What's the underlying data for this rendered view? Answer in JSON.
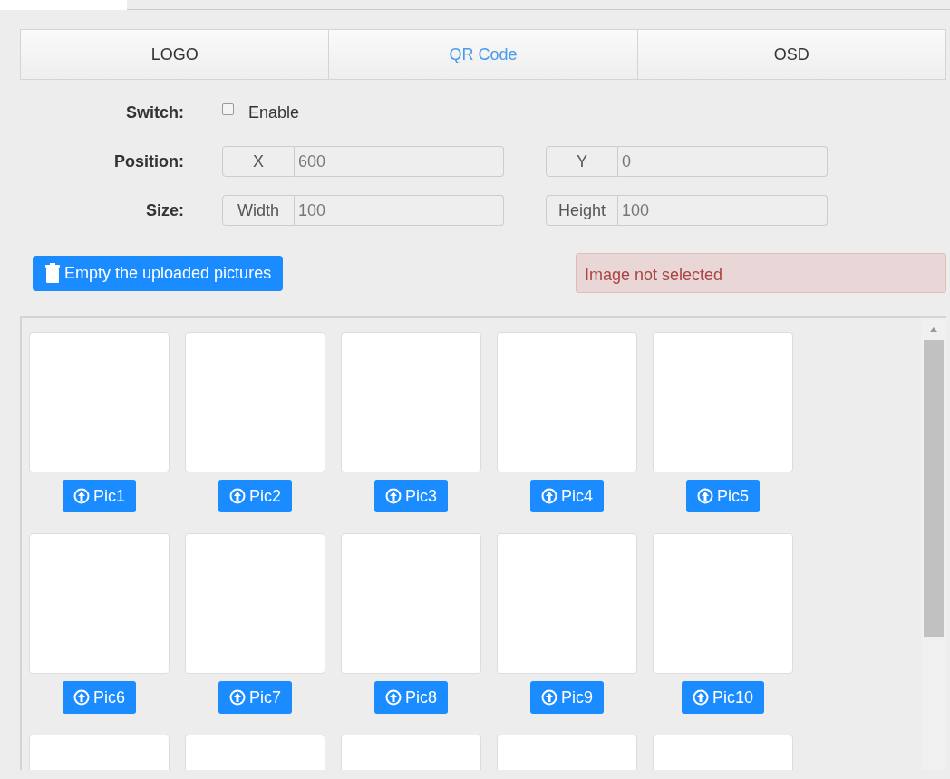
{
  "tabs": [
    {
      "label": "LOGO",
      "selected": false
    },
    {
      "label": "QR Code",
      "selected": true
    },
    {
      "label": "OSD",
      "selected": false
    }
  ],
  "switch": {
    "label": "Switch:",
    "option": "Enable",
    "checked": false
  },
  "position": {
    "label": "Position:",
    "fields": [
      {
        "addon": "X",
        "value": "600"
      },
      {
        "addon": "Y",
        "value": "0"
      }
    ]
  },
  "size": {
    "label": "Size:",
    "fields": [
      {
        "addon": "Width",
        "value": "100"
      },
      {
        "addon": "Height",
        "value": "100"
      }
    ]
  },
  "empty_button": "Empty the uploaded pictures",
  "alert": "Image not selected",
  "pictures": [
    {
      "kind": "upload",
      "label": "Pic1"
    },
    {
      "kind": "upload",
      "label": "Pic2"
    },
    {
      "kind": "upload",
      "label": "Pic3"
    },
    {
      "kind": "upload",
      "label": "Pic4"
    },
    {
      "kind": "upload",
      "label": "Pic5"
    },
    {
      "kind": "upload",
      "label": "Pic6"
    },
    {
      "kind": "upload",
      "label": "Pic7"
    },
    {
      "kind": "upload",
      "label": "Pic8"
    },
    {
      "kind": "upload",
      "label": "Pic9"
    },
    {
      "kind": "upload",
      "label": "Pic10"
    },
    {
      "kind": "blank"
    },
    {
      "kind": "blank"
    },
    {
      "kind": "blank"
    },
    {
      "kind": "blank"
    },
    {
      "kind": "blank"
    }
  ]
}
